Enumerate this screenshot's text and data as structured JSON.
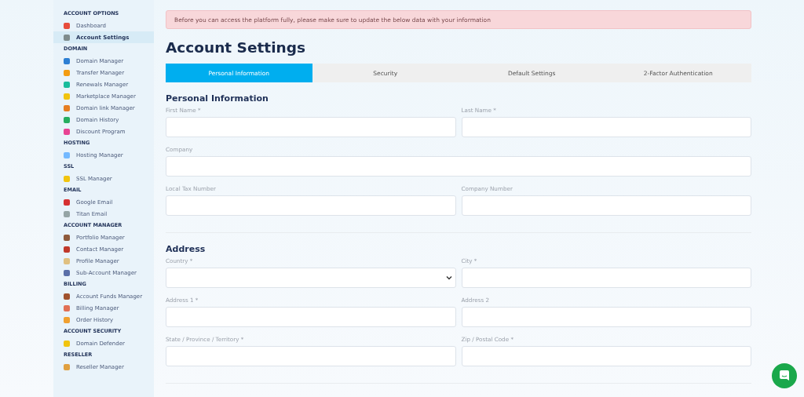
{
  "sidebar": {
    "groups": [
      {
        "heading": "ACCOUNT OPTIONS",
        "items": [
          {
            "label": "Dashboard",
            "selected": false
          },
          {
            "label": "Account Settings",
            "selected": true
          }
        ]
      },
      {
        "heading": "DOMAIN",
        "items": [
          {
            "label": "Domain Manager",
            "selected": false
          },
          {
            "label": "Transfer Manager",
            "selected": false
          },
          {
            "label": "Renewals Manager",
            "selected": false
          },
          {
            "label": "Marketplace Manager",
            "selected": false
          },
          {
            "label": "Domain link Manager",
            "selected": false
          },
          {
            "label": "Domain History",
            "selected": false
          },
          {
            "label": "Discount Program",
            "selected": false
          }
        ]
      },
      {
        "heading": "HOSTING",
        "items": [
          {
            "label": "Hosting Manager",
            "selected": false
          }
        ]
      },
      {
        "heading": "SSL",
        "items": [
          {
            "label": "SSL Manager",
            "selected": false
          }
        ]
      },
      {
        "heading": "EMAIL",
        "items": [
          {
            "label": "Google Email",
            "selected": false
          },
          {
            "label": "Titan Email",
            "selected": false
          }
        ]
      },
      {
        "heading": "ACCOUNT MANAGER",
        "items": [
          {
            "label": "Portfolio Manager",
            "selected": false
          },
          {
            "label": "Contact Manager",
            "selected": false
          },
          {
            "label": "Profile Manager",
            "selected": false
          },
          {
            "label": "Sub-Account Manager",
            "selected": false
          }
        ]
      },
      {
        "heading": "BILLING",
        "items": [
          {
            "label": "Account Funds Manager",
            "selected": false
          },
          {
            "label": "Billing Manager",
            "selected": false
          },
          {
            "label": "Order History",
            "selected": false
          }
        ]
      },
      {
        "heading": "ACCOUNT SECURITY",
        "items": [
          {
            "label": "Domain Defender",
            "selected": false
          }
        ]
      },
      {
        "heading": "RESELLER",
        "items": [
          {
            "label": "Reseller Manager",
            "selected": false
          }
        ]
      }
    ]
  },
  "alert": "Before you can access the platform fully, please make sure to update the below data with your information",
  "title": "Account Settings",
  "tabs": [
    {
      "label": "Personal Information",
      "selected": true
    },
    {
      "label": "Security",
      "selected": false
    },
    {
      "label": "Default Settings",
      "selected": false
    },
    {
      "label": "2-Factor Authentication",
      "selected": false
    }
  ],
  "sections": [
    {
      "heading": "Personal Information",
      "fields": [
        {
          "label": "First Name *",
          "kind": "text",
          "wide": false
        },
        {
          "label": "Last Name *",
          "kind": "text",
          "wide": false
        },
        {
          "label": "Company",
          "kind": "text",
          "wide": true
        },
        {
          "label": "Local Tax Number",
          "kind": "text",
          "wide": false
        },
        {
          "label": "Company Number",
          "kind": "text",
          "wide": false
        }
      ]
    },
    {
      "heading": "Address",
      "fields": [
        {
          "label": "Country *",
          "kind": "select",
          "wide": false
        },
        {
          "label": "City *",
          "kind": "text",
          "wide": false
        },
        {
          "label": "Address 1 *",
          "kind": "text",
          "wide": false
        },
        {
          "label": "Address 2",
          "kind": "text",
          "wide": false
        },
        {
          "label": "State / Province / Territory *",
          "kind": "text",
          "wide": false
        },
        {
          "label": "Zip / Postal Code *",
          "kind": "text",
          "wide": false
        }
      ]
    }
  ]
}
